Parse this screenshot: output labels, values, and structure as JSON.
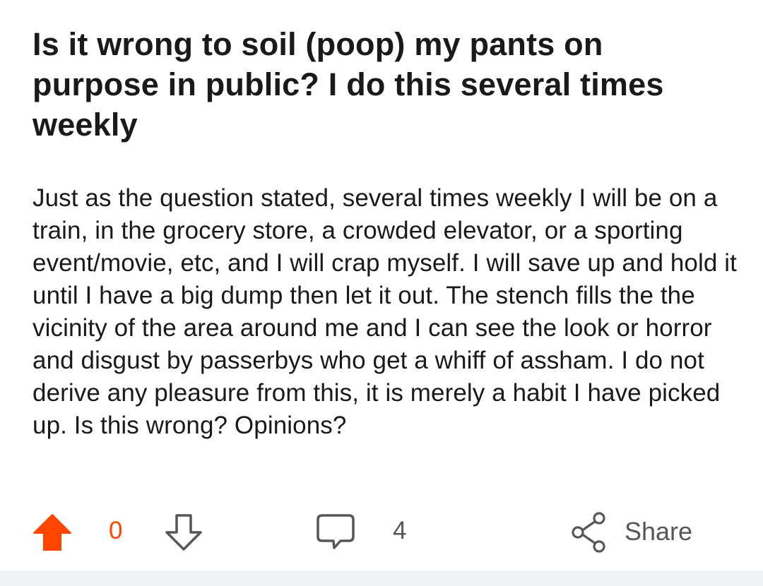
{
  "post": {
    "title": "Is it wrong to soil (poop) my pants on purpose in public? I do this several times weekly",
    "body": "Just as the question stated, several times weekly I will be on a train, in the grocery store, a crowded elevator, or a sporting event/movie, etc, and I will crap myself. I will save up and hold it until I have a big dump then let it out. The stench fills the the vicinity of the area around me and I can see the look or horror and disgust by passerbys who get a whiff of assham. I do not derive any pleasure from this, it is merely a habit I have picked up. Is this wrong? Opinions?"
  },
  "actions": {
    "vote_count": "0",
    "comment_count": "4",
    "share_label": "Share",
    "upvote_icon": "arrow-up-filled-icon",
    "downvote_icon": "arrow-down-outline-icon",
    "comment_icon": "speech-bubble-icon",
    "share_icon": "share-nodes-icon"
  },
  "colors": {
    "upvote_active": "#ff4500",
    "icon_gray": "#565758",
    "bottom_strip": "#f1f2f3"
  }
}
